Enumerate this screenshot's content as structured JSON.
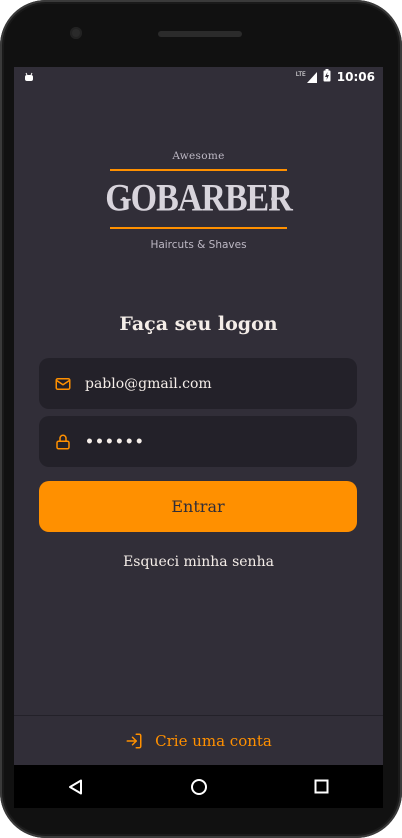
{
  "status_bar": {
    "network": "LTE",
    "time": "10:06"
  },
  "logo": {
    "top_text": "Awesome",
    "wordmark": "GOBARBER",
    "bottom_text": "Haircuts & Shaves"
  },
  "login": {
    "title": "Faça seu logon",
    "email_value": "pablo@gmail.com",
    "password_value": "••••••",
    "submit_label": "Entrar",
    "forgot_label": "Esqueci minha senha"
  },
  "footer": {
    "create_account_label": "Crie uma conta"
  },
  "colors": {
    "background": "#312e38",
    "input_background": "#232129",
    "accent": "#ff9000",
    "text": "#f4ede8"
  },
  "icons": {
    "email": "mail-icon",
    "password": "lock-icon",
    "create_account": "log-in-icon"
  }
}
